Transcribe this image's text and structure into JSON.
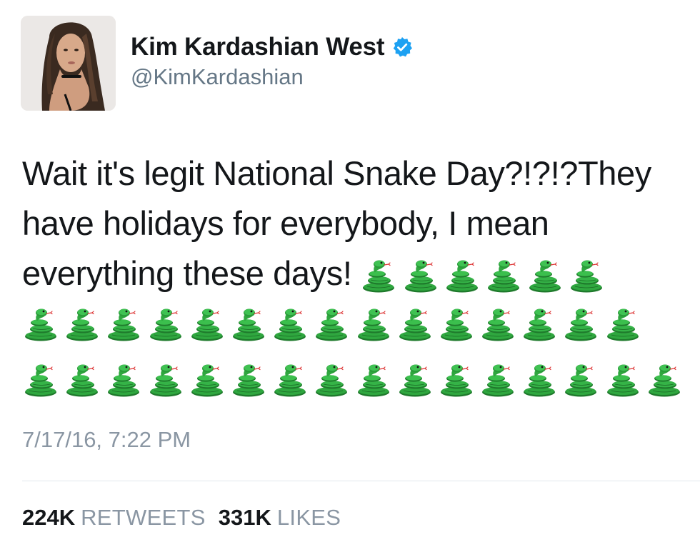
{
  "author": {
    "display_name": "Kim Kardashian West",
    "handle": "@KimKardashian",
    "verified": true,
    "verified_badge_color": "#1da1f2"
  },
  "tweet": {
    "text_lines": [
      "Wait it's legit National Snake Day?!?!?They",
      "have holidays for everybody, I mean",
      "everything these days!"
    ],
    "emoji": "snake-emoji",
    "emoji_counts": {
      "line3": 6,
      "row4": 15,
      "row5": 16
    },
    "timestamp": "7/17/16, 7:22 PM"
  },
  "stats": {
    "retweets_count": "224K",
    "retweets_label": "RETWEETS",
    "likes_count": "331K",
    "likes_label": "LIKES"
  },
  "colors": {
    "text": "#14171a",
    "muted": "#8a96a3",
    "snake_green": "#2e9a3c"
  }
}
